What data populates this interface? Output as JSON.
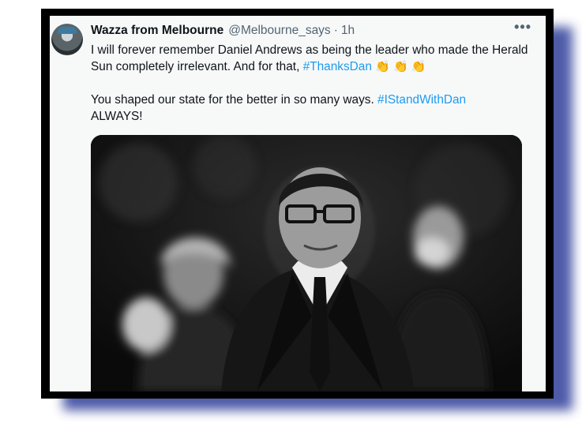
{
  "tweet": {
    "display_name": "Wazza from Melbourne",
    "handle": "@Melbourne_says",
    "separator": "·",
    "time": "1h",
    "more_label": "•••",
    "line1_prefix": "I will forever remember Daniel Andrews as being the leader who made the Herald Sun completely irrelevant. And for that, ",
    "hashtag1": "#ThanksDan",
    "claps": "👏 👏 👏",
    "line2_prefix": "You shaped our state for the better in so many ways. ",
    "hashtag2": "#IStandWithDan",
    "line2_suffix": "ALWAYS!"
  },
  "icons": {
    "avatar": "user-avatar",
    "more": "more-options-icon",
    "clap": "clapping-hands-emoji"
  }
}
